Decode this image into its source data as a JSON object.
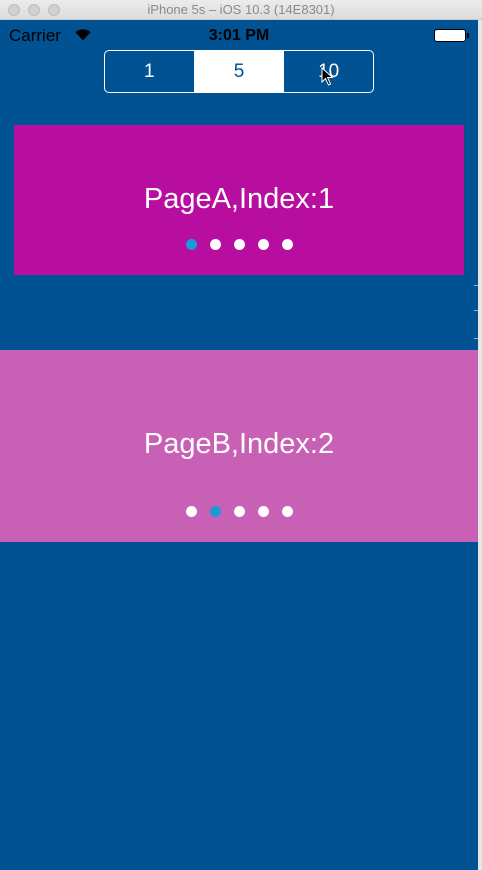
{
  "window": {
    "title": "iPhone 5s – iOS 10.3 (14E8301)"
  },
  "status_bar": {
    "carrier": "Carrier",
    "time": "3:01 PM",
    "wifi_icon": "wifi-icon",
    "battery_icon": "battery-icon"
  },
  "segmented_control": {
    "segments": [
      "1",
      "5",
      "10"
    ],
    "selected": "5"
  },
  "pages": [
    {
      "label": "PageA,Index:1",
      "color": "#b80ea0",
      "dot_count": 5,
      "active_dot": 1
    },
    {
      "label": "PageB,Index:2",
      "color": "#c860b5",
      "dot_count": 5,
      "active_dot": 2
    }
  ],
  "colors": {
    "background": "#005292",
    "active_dot": "#1a9ad8",
    "inactive_dot": "#ffffff"
  }
}
